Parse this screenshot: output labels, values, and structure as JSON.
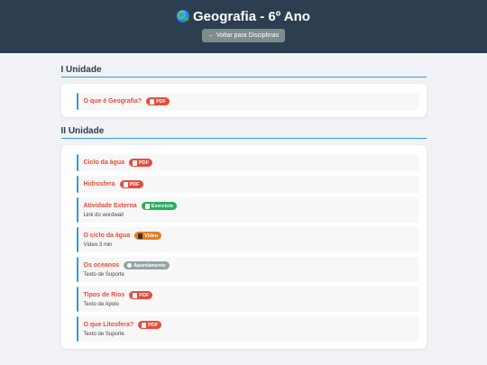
{
  "header": {
    "title": "Geografia - 6º Ano",
    "back_label": "← Voltar para Disciplinas"
  },
  "units": [
    {
      "title": "I Unidade",
      "items": [
        {
          "title": "O que é Geografia?",
          "badge": "PDF",
          "badge_type": "pdf",
          "desc": ""
        }
      ]
    },
    {
      "title": "II Unidade",
      "items": [
        {
          "title": "Ciclo da água",
          "badge": "PDF",
          "badge_type": "pdf",
          "desc": ""
        },
        {
          "title": "Hidrosfera",
          "badge": "PDF",
          "badge_type": "pdf",
          "desc": ""
        },
        {
          "title": "Atividade Externa",
          "badge": "Exercício",
          "badge_type": "exercise",
          "desc": "Link do wordwall"
        },
        {
          "title": "O ciclo da água",
          "badge": "Vídeo",
          "badge_type": "video",
          "desc": "Vídeo 3 min"
        },
        {
          "title": "Os oceanos",
          "badge": "Apontamento",
          "badge_type": "note",
          "desc": "Texto de Suporte"
        },
        {
          "title": "Tipos de Rios",
          "badge": "PDF",
          "badge_type": "pdf",
          "desc": "Texto de Apoio"
        },
        {
          "title": "O que Litosfera?",
          "badge": "PDF",
          "badge_type": "pdf",
          "desc": "Texto de Suporte"
        }
      ]
    }
  ],
  "badge_colors": {
    "pdf": "#e74c3c",
    "exercise": "#27ae60",
    "video": "#e67e22",
    "note": "#95a5a6"
  },
  "badge_icons": {
    "pdf": "document-icon",
    "exercise": "checklist-icon",
    "video": "film-icon",
    "note": "pin-icon"
  }
}
